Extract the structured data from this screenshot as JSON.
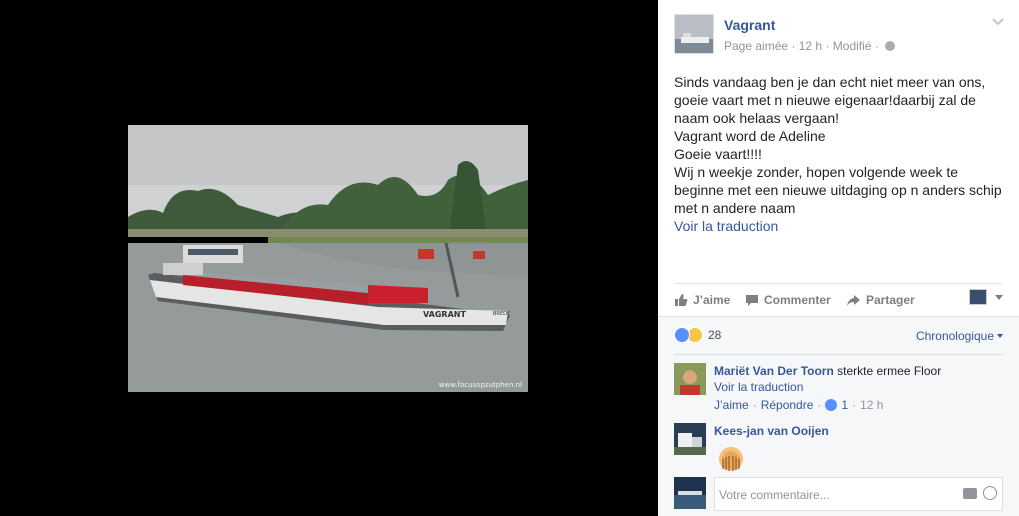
{
  "photo": {
    "watermark": "www.focusopzutphen.nl",
    "boat_name": "VAGRANT",
    "boat_port": "BREDE"
  },
  "post": {
    "page_name": "Vagrant",
    "meta_type": "Page aimée",
    "meta_time": "12 h",
    "meta_edited": "Modifié",
    "lines": [
      "Sinds vandaag ben je dan echt niet meer van ons,",
      "goeie vaart met n nieuwe eigenaar!daarbij zal de",
      "naam ook helaas vergaan!",
      "Vagrant word de Adeline",
      "Goeie vaart!!!!",
      "Wij n weekje zonder, hopen volgende week te",
      "beginne met een nieuwe uitdaging op n anders schip",
      "met n andere naam"
    ],
    "see_translation": "Voir la traduction"
  },
  "actions": {
    "like": "J’aime",
    "comment": "Commenter",
    "share": "Partager"
  },
  "reactions": {
    "count": "28",
    "sort_label": "Chronologique"
  },
  "comments": [
    {
      "author": "Mariët Van Der Toorn",
      "text": "sterkte ermee Floor",
      "see_translation": "Voir la traduction",
      "like_label": "J’aime",
      "reply_label": "Répondre",
      "likes": "1",
      "time": "12 h"
    },
    {
      "author": "Kees-jan van Ooijen"
    }
  ],
  "composer": {
    "placeholder": "Votre commentaire..."
  },
  "colors": {
    "link": "#365899",
    "muted": "#90949c",
    "like_blue": "#5890ff"
  }
}
